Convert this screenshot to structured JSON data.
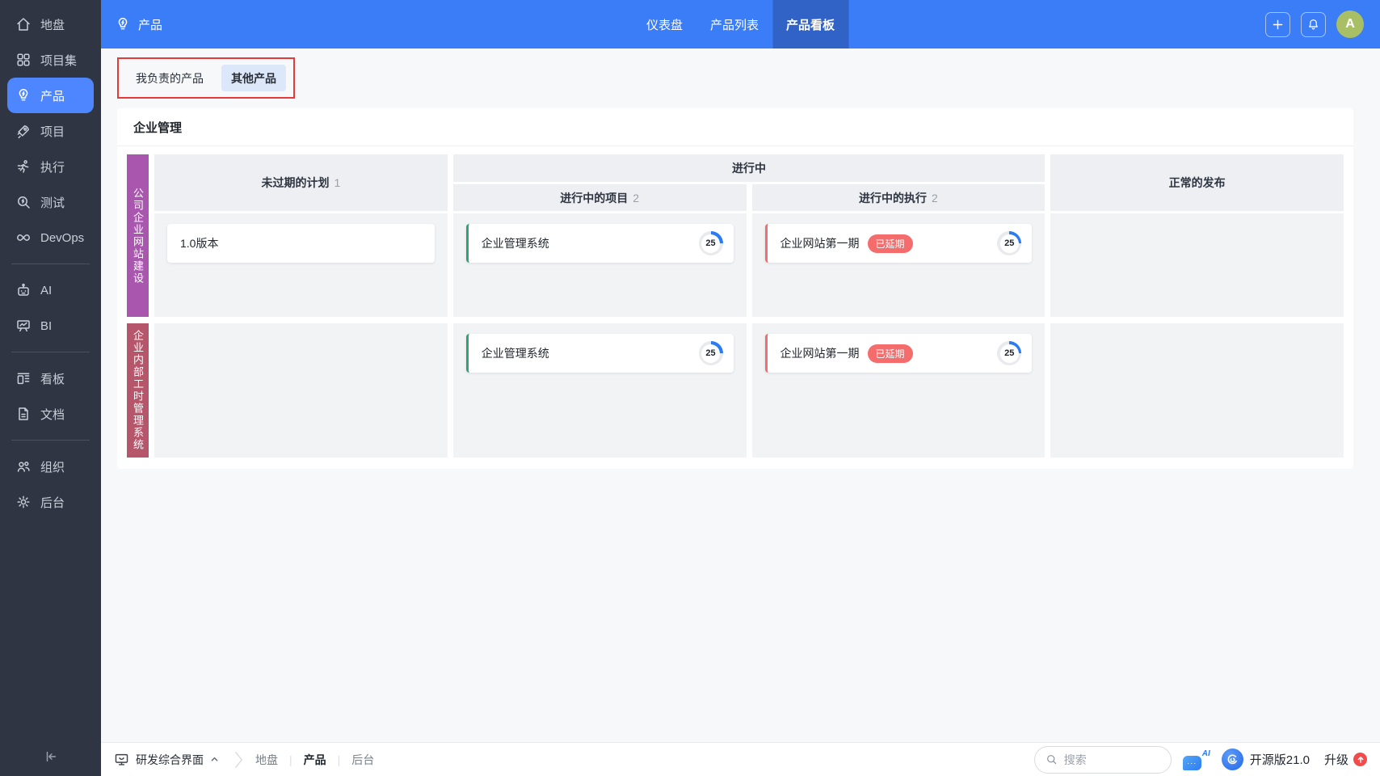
{
  "colors": {
    "accent_blue": "#3b7cf7",
    "active_top_tab": "#3163c6",
    "sidebar_bg": "#2f3543",
    "sidebar_active": "#4e86ff",
    "lane1": "#a957ae",
    "lane2": "#b5566b",
    "card_green_border": "#2fa56f",
    "card_red_border": "#f56c6c",
    "delay_badge": "#f56c6c",
    "progress_blue": "#2b7bf3",
    "avatar_green": "#a9bf66",
    "annotation_red": "#e63a3a",
    "upgrade_red": "#f34b4b"
  },
  "sidebar": {
    "items": [
      {
        "label": "地盘"
      },
      {
        "label": "项目集"
      },
      {
        "label": "产品"
      },
      {
        "label": "项目"
      },
      {
        "label": "执行"
      },
      {
        "label": "测试"
      },
      {
        "label": "DevOps"
      },
      {
        "label": "AI"
      },
      {
        "label": "BI"
      },
      {
        "label": "看板"
      },
      {
        "label": "文档"
      },
      {
        "label": "组织"
      },
      {
        "label": "后台"
      }
    ]
  },
  "header": {
    "title": "产品",
    "tabs": [
      {
        "label": "仪表盘"
      },
      {
        "label": "产品列表"
      },
      {
        "label": "产品看板"
      }
    ],
    "avatar_initial": "A"
  },
  "filter_tabs": {
    "mine": "我负责的产品",
    "other": "其他产品"
  },
  "board": {
    "section_title": "企业管理",
    "columns": {
      "plan": {
        "label": "未过期的计划",
        "count": "1"
      },
      "doing": {
        "label": "进行中"
      },
      "doing_project": {
        "label": "进行中的项目",
        "count": "2"
      },
      "doing_execution": {
        "label": "进行中的执行",
        "count": "2"
      },
      "release": {
        "label": "正常的发布"
      }
    },
    "lanes": [
      {
        "name": "公司企业网站建设",
        "color": "#a957ae",
        "plan_card": {
          "title": "1.0版本"
        },
        "project_card": {
          "title": "企业管理系统",
          "progress": "25"
        },
        "execution_card": {
          "title": "企业网站第一期",
          "badge": "已延期",
          "progress": "25"
        }
      },
      {
        "name": "企业内部工时管理系统",
        "color": "#b5566b",
        "project_card": {
          "title": "企业管理系统",
          "progress": "25"
        },
        "execution_card": {
          "title": "企业网站第一期",
          "badge": "已延期",
          "progress": "25"
        }
      }
    ]
  },
  "footer": {
    "app_switcher": "研发综合界面",
    "crumbs": [
      "地盘",
      "产品",
      "后台"
    ],
    "search_placeholder": "搜索",
    "version": "开源版21.0",
    "upgrade": "升级"
  }
}
